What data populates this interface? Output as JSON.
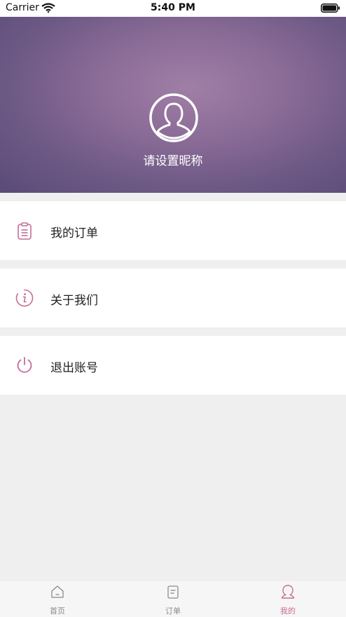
{
  "status_bar": {
    "carrier": "Carrier",
    "time": "5:40 PM"
  },
  "profile": {
    "nickname": "请设置昵称"
  },
  "menu": {
    "orders": "我的订单",
    "about": "关于我们",
    "logout": "退出账号"
  },
  "tabs": [
    {
      "label": "首页"
    },
    {
      "label": "订单"
    },
    {
      "label": "我的"
    }
  ],
  "colors": {
    "accent": "#c46d97",
    "header_purple": "#8b6c97",
    "background": "#efeff0"
  }
}
